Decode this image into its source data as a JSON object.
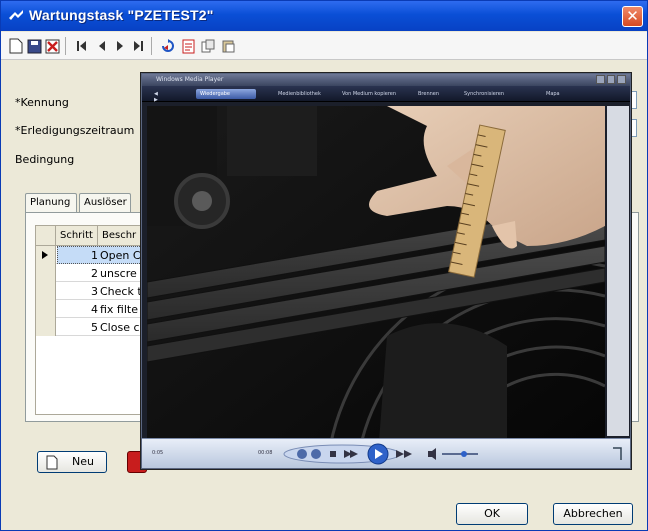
{
  "window": {
    "title": "Wartungstask \"PZETEST2\"",
    "close_glyph": "✕"
  },
  "toolbar": {
    "icons": [
      "new-document-icon",
      "save-icon",
      "delete-icon",
      "first-record-icon",
      "previous-record-icon",
      "next-record-icon",
      "last-record-icon",
      "refresh-icon",
      "report-icon",
      "copy-icon",
      "paste-icon"
    ]
  },
  "form": {
    "kennung_label": "*Kennung",
    "erledigung_label": "*Erledigungszeitraum",
    "bedingung_label": "Bedingung"
  },
  "tabs": [
    {
      "label": "Planung"
    },
    {
      "label": "Auslöser"
    }
  ],
  "grid": {
    "headers": [
      "Schritt",
      "Beschr"
    ],
    "rows": [
      {
        "num": "1",
        "text": "Open C",
        "selected": true
      },
      {
        "num": "2",
        "text": "unscre"
      },
      {
        "num": "3",
        "text": "Check t"
      },
      {
        "num": "4",
        "text": "fix filte"
      },
      {
        "num": "5",
        "text": "Close c"
      }
    ]
  },
  "buttons": {
    "neu": "Neu",
    "ok": "OK",
    "abbrechen": "Abbrechen"
  },
  "media_player": {
    "title": "Windows Media Player",
    "nav": [
      {
        "label": "Wiedergabe",
        "active": true
      },
      {
        "label": "Medienbibliothek"
      },
      {
        "label": "Von Medium kopieren"
      },
      {
        "label": "Brennen"
      },
      {
        "label": "Synchronisieren"
      },
      {
        "label": "Mapa"
      }
    ],
    "left_status": "0:05",
    "time": "00:08"
  },
  "colors": {
    "title_bar": "#0a4fd6",
    "window_bg": "#ece9d8",
    "close_button": "#d64a22",
    "selection": "#c5dcf7"
  }
}
